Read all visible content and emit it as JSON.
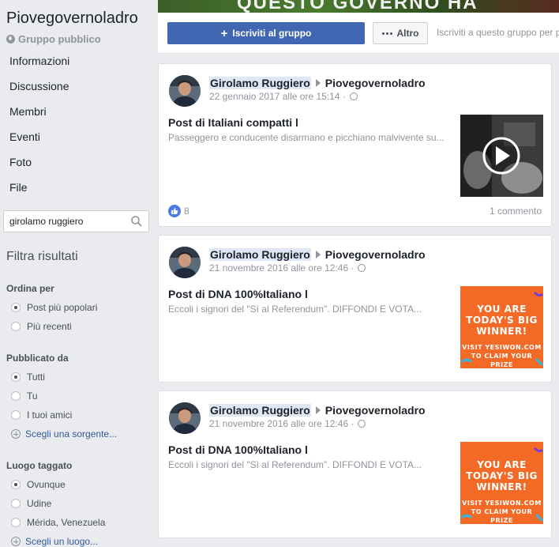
{
  "sidebar": {
    "group_name": "Piovegovernoladro",
    "group_type": "Gruppo pubblico",
    "nav": [
      "Informazioni",
      "Discussione",
      "Membri",
      "Eventi",
      "Foto",
      "File"
    ],
    "search_value": "girolamo ruggiero",
    "filter_title": "Filtra risultati",
    "sort_heading": "Ordina per",
    "sort_options": [
      "Post più popolari",
      "Più recenti"
    ],
    "posted_by_heading": "Pubblicato da",
    "posted_by_options": [
      "Tutti",
      "Tu",
      "I tuoi amici"
    ],
    "choose_source": "Scegli una sorgente...",
    "location_heading": "Luogo taggato",
    "location_options": [
      "Ovunque",
      "Udine",
      "Mérida, Venezuela"
    ],
    "choose_location": "Scegli un luogo..."
  },
  "header": {
    "cover_text": "QUESTO GOVERNO HA",
    "join_label": "Iscriviti al gruppo",
    "more_label": "Altro",
    "join_hint": "Iscriviti a questo gruppo per p"
  },
  "posts": [
    {
      "author": "Girolamo Ruggiero",
      "group": "Piovegovernoladro",
      "date": "22 gennaio 2017 alle ore 15:14 ·",
      "title": "Post di Italiani compatti l",
      "desc": "Passeggero e conducente disarmano e picchiano malvivente su...",
      "likes": "8",
      "comments": "1 commento"
    },
    {
      "author": "Girolamo Ruggiero",
      "group": "Piovegovernoladro",
      "date": "21 novembre 2016 alle ore 12:46 ·",
      "title": "Post di DNA 100%Italiano l",
      "desc": "Eccoli i signori del \"Sì al Referendum\". DIFFONDI E VOTA...",
      "ad_lines": [
        "YOU ARE",
        "TODAY'S BIG",
        "WINNER!"
      ],
      "ad_small": [
        "VISIT YESIWON.COM",
        "TO CLAIM YOUR PRIZE"
      ]
    },
    {
      "author": "Girolamo Ruggiero",
      "group": "Piovegovernoladro",
      "date": "21 novembre 2016 alle ore 12:46 ·",
      "title": "Post di DNA 100%Italiano l",
      "desc": "Eccoli i signori del \"Sì al Referendum\". DIFFONDI E VOTA...",
      "ad_lines": [
        "YOU ARE",
        "TODAY'S BIG",
        "WINNER!"
      ],
      "ad_small": [
        "VISIT YESIWON.COM",
        "TO CLAIM YOUR PRIZE"
      ]
    }
  ],
  "colors": {
    "background": "#e9ebee",
    "brand_blue": "#4267b2",
    "link": "#365899",
    "ad_orange": "#f26a26"
  }
}
